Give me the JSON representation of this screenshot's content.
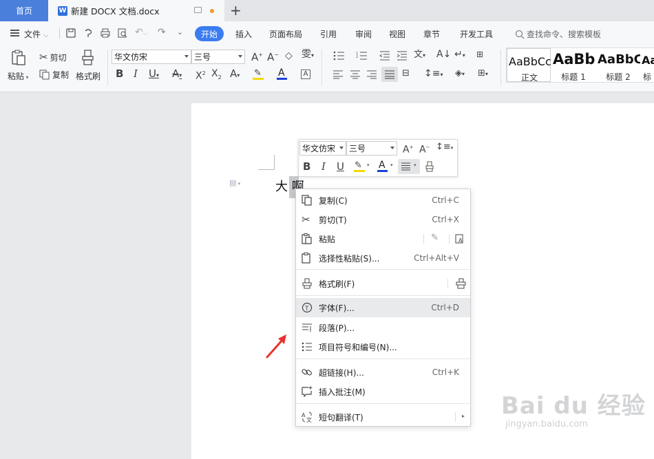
{
  "tabs": {
    "home": "首页",
    "doc_title": "新建 DOCX 文档.docx",
    "new_tab": "+"
  },
  "menu": {
    "file": "文件",
    "items": [
      "开始",
      "插入",
      "页面布局",
      "引用",
      "审阅",
      "视图",
      "章节",
      "开发工具"
    ],
    "search_placeholder": "查找命令、搜索模板"
  },
  "ribbon": {
    "paste": "粘贴",
    "cut": "剪切",
    "copy": "复制",
    "format_painter": "格式刷",
    "font_name": "华文仿宋",
    "font_size": "三号",
    "styles": [
      {
        "preview": "AaBbCcDd",
        "label": "正文"
      },
      {
        "preview": "AaBb",
        "label": "标题 1"
      },
      {
        "preview": "AaBbC",
        "label": "标题 2"
      },
      {
        "preview": "Aa",
        "label": "标"
      }
    ]
  },
  "document": {
    "text_plain": "大",
    "text_selected": "啊"
  },
  "mini_toolbar": {
    "font_name": "华文仿宋",
    "font_size": "三号"
  },
  "context_menu": {
    "items": [
      {
        "label": "复制(C)",
        "shortcut": "Ctrl+C"
      },
      {
        "label": "剪切(T)",
        "shortcut": "Ctrl+X"
      },
      {
        "label": "粘贴",
        "shortcut": ""
      },
      {
        "label": "选择性粘贴(S)...",
        "shortcut": "Ctrl+Alt+V"
      },
      {
        "label": "格式刷(F)",
        "shortcut": ""
      },
      {
        "label": "字体(F)...",
        "shortcut": "Ctrl+D"
      },
      {
        "label": "段落(P)...",
        "shortcut": ""
      },
      {
        "label": "项目符号和编号(N)...",
        "shortcut": ""
      },
      {
        "label": "超链接(H)...",
        "shortcut": "Ctrl+K"
      },
      {
        "label": "插入批注(M)",
        "shortcut": ""
      },
      {
        "label": "短句翻译(T)",
        "shortcut": ""
      }
    ]
  },
  "watermark": {
    "brand": "Bai du 经验",
    "url": "jingyan.baidu.com"
  },
  "colors": {
    "accent": "#3b7cf0",
    "home_tab": "#4a7fdb",
    "arrow": "#e8332a",
    "highlight_yellow": "#f5d800",
    "font_color_blue": "#1c3fd6"
  }
}
